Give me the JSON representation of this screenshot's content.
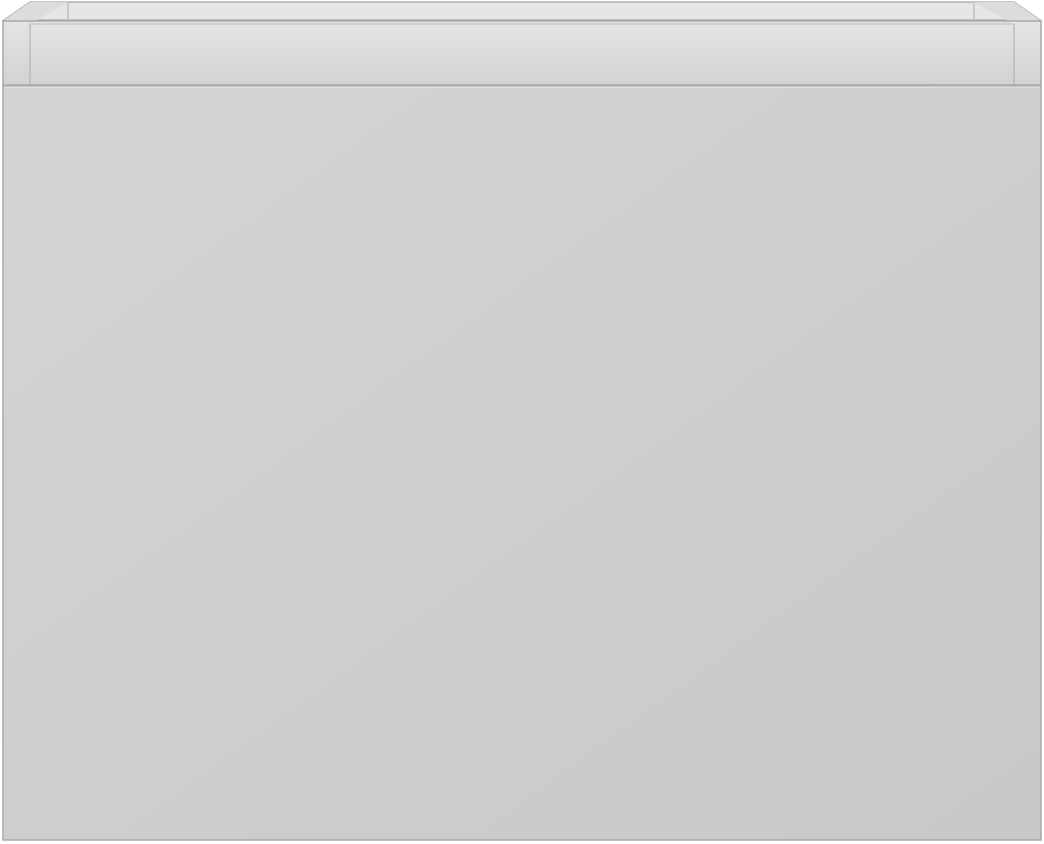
{
  "object": {
    "kind": "wall-mounted vanity cabinet with drawer",
    "colors": {
      "body": "#cfcfcd",
      "front_light": "#d4d4d2",
      "front_dark": "#c8c8c6",
      "rim": "#dadad8",
      "inner_wall": "#e2e2e0",
      "edge": "#a9a9a7",
      "background": "#ffffff"
    }
  }
}
